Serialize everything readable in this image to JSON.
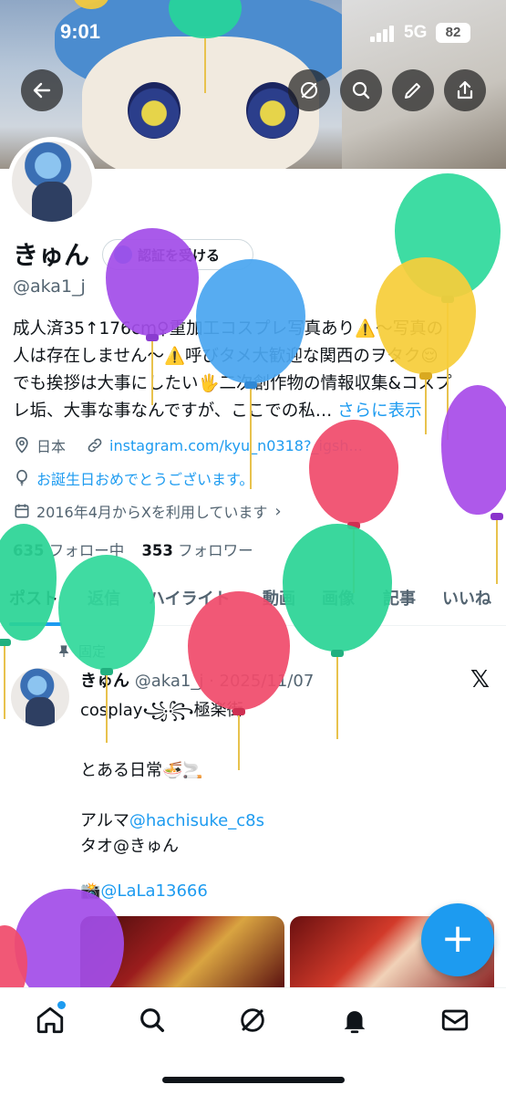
{
  "status_bar": {
    "time": "9:01",
    "network": "5G",
    "battery": "82"
  },
  "profile": {
    "name": "きゅん",
    "handle": "@aka1_j",
    "verify_button": "認証を受ける",
    "bio_lines": [
      "成人済35↑176cm♀重加工コスプレ写真あり⚠️〜写真の",
      "人は存在しません〜⚠️呼びタメ大歓迎な関西のヲタク😌",
      "でも挨拶は大事にしたい🖐二次創作物の情報収集&コスプ",
      "レ垢、大事な事なんですが、ここでの私…"
    ],
    "bio_more": "さらに表示",
    "location": "日本",
    "link": "instagram.com/kyu_n0318?_igsh...",
    "birthday": "お誕生日おめでとうございます。",
    "joined": "2016年4月からXを利用しています",
    "following_count": "635",
    "following_label": "フォロー中",
    "followers_count": "353",
    "followers_label": "フォロワー"
  },
  "tabs": [
    "ポスト",
    "返信",
    "ハイライト",
    "動画",
    "画像",
    "記事",
    "いいね"
  ],
  "post": {
    "pinned_label": "固定",
    "author": "きゅん",
    "handle_date": "@aka1_j · 2025/11/07",
    "lines": {
      "l1": "cosplay꧁꧂極楽街",
      "l2": "とある日常🍜🚬",
      "l3_prefix": "アルマ",
      "l3_mention": "@hachisuke_c8s",
      "l4": "タオ@きゅん",
      "l5_prefix": "📸",
      "l5_mention": "@LaLa13666"
    }
  },
  "fab_label": "+",
  "icons": {
    "top": [
      "back-arrow-icon",
      "grok-icon",
      "search-icon",
      "edit-icon",
      "share-icon"
    ],
    "nav": [
      "home-icon",
      "search-icon",
      "grok-icon",
      "bell-icon",
      "mail-icon"
    ]
  },
  "colors": {
    "accent": "#1d9bf0",
    "text": "#0f1419",
    "secondary": "#536471"
  }
}
